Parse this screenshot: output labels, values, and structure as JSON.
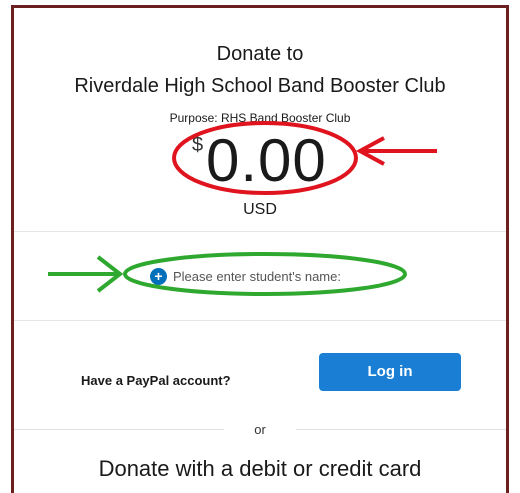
{
  "header": {
    "donate_title": "Donate to",
    "org_name": "Riverdale High School Band Booster Club",
    "purpose": "Purpose: RHS Band Booster Club"
  },
  "amount": {
    "currency_symbol": "$",
    "value": "0.00",
    "currency_code": "USD"
  },
  "student": {
    "plus_icon": "plus-circle-icon",
    "label": "Please enter student's name:"
  },
  "login": {
    "question": "Have a PayPal account?",
    "button_label": "Log in"
  },
  "divider": {
    "or_text": "or"
  },
  "card": {
    "title": "Donate with a debit or credit card"
  },
  "colors": {
    "frame_border": "#6b1f1f",
    "button_blue": "#1a7fd4",
    "annotation_red": "#e0141e",
    "annotation_green": "#2ea82e"
  }
}
